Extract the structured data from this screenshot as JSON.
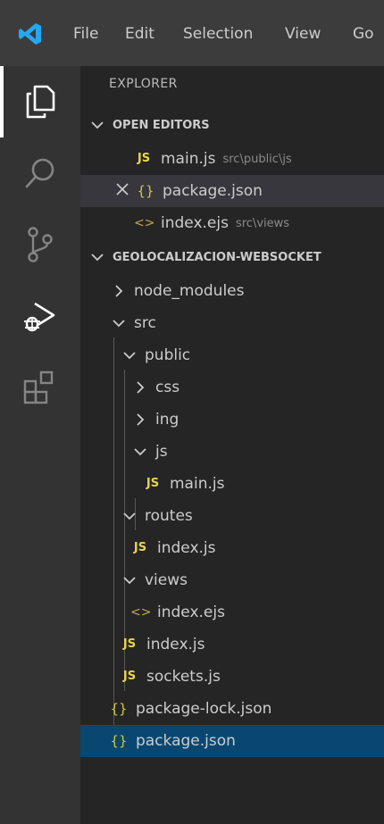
{
  "menu": [
    "File",
    "Edit",
    "Selection",
    "View",
    "Go"
  ],
  "colors": {
    "accent": "#0078d4",
    "focus_bg": "#094771",
    "js": "#e8d44d",
    "json": "#cbcb41"
  },
  "activitybar": [
    {
      "name": "explorer-icon",
      "active": true
    },
    {
      "name": "search-icon",
      "active": false
    },
    {
      "name": "source-control-icon",
      "active": false
    },
    {
      "name": "run-debug-icon",
      "active": false
    },
    {
      "name": "extensions-icon",
      "active": false
    }
  ],
  "sidebar": {
    "title": "EXPLORER",
    "open_editors": {
      "label": "OPEN EDITORS",
      "items": [
        {
          "icon": "JS",
          "name": "main.js",
          "desc": "src\\public\\js"
        },
        {
          "icon": "{}",
          "name": "package.json",
          "desc": ""
        },
        {
          "icon": "<>",
          "name": "index.ejs",
          "desc": "src\\views"
        }
      ]
    },
    "project": {
      "label": "GEOLOCALIZACION-WEBSOCKET",
      "items": [
        {
          "type": "folder",
          "name": "node_modules",
          "open": false
        },
        {
          "type": "folder",
          "name": "src",
          "open": true
        },
        {
          "type": "folder",
          "name": "public",
          "open": true
        },
        {
          "type": "folder",
          "name": "css",
          "open": false
        },
        {
          "type": "folder",
          "name": "ing",
          "open": false
        },
        {
          "type": "folder",
          "name": "js",
          "open": true
        },
        {
          "type": "file",
          "icon": "JS",
          "name": "main.js"
        },
        {
          "type": "folder",
          "name": "routes",
          "open": true
        },
        {
          "type": "file",
          "icon": "JS",
          "name": "index.js"
        },
        {
          "type": "folder",
          "name": "views",
          "open": true
        },
        {
          "type": "file",
          "icon": "<>",
          "name": "index.ejs"
        },
        {
          "type": "file",
          "icon": "JS",
          "name": "index.js"
        },
        {
          "type": "file",
          "icon": "JS",
          "name": "sockets.js"
        },
        {
          "type": "file",
          "icon": "{}",
          "name": "package-lock.json"
        },
        {
          "type": "file",
          "icon": "{}",
          "name": "package.json"
        }
      ]
    }
  }
}
